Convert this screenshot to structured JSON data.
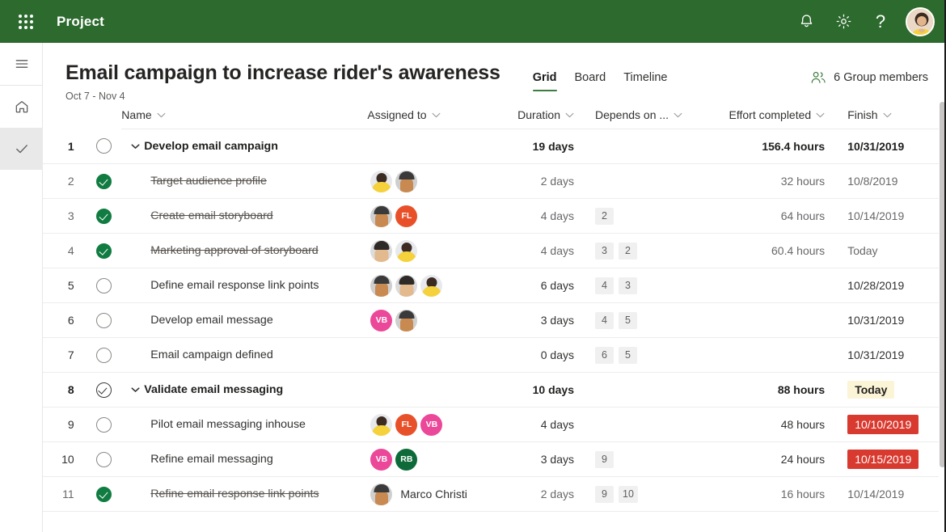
{
  "topbar": {
    "waffle_label": "App launcher",
    "app_title": "Project",
    "notifications_icon": "bell-icon",
    "settings_icon": "gear-icon",
    "help_label": "?",
    "avatar_label": "User account",
    "background_color": "#2d6a2e"
  },
  "rail": {
    "menu_icon": "hamburger-menu-icon",
    "home_icon": "home-icon",
    "tasks_icon": "checkmark-icon"
  },
  "header": {
    "title": "Email campaign to increase rider's awareness",
    "date_range": "Oct 7 - Nov 4",
    "tabs": [
      {
        "label": "Grid",
        "active": true
      },
      {
        "label": "Board",
        "active": false
      },
      {
        "label": "Timeline",
        "active": false
      }
    ],
    "group_members_label": "6 Group members",
    "group_members_icon": "people-icon",
    "accent_color": "#3e7d41"
  },
  "grid": {
    "columns": [
      {
        "key": "num",
        "label": ""
      },
      {
        "key": "check",
        "label": ""
      },
      {
        "key": "name",
        "label": "Name",
        "sortable": true
      },
      {
        "key": "assigned",
        "label": "Assigned to",
        "sortable": true
      },
      {
        "key": "duration",
        "label": "Duration",
        "sortable": true
      },
      {
        "key": "depends",
        "label": "Depends on ...",
        "sortable": true
      },
      {
        "key": "effort",
        "label": "Effort completed",
        "sortable": true
      },
      {
        "key": "finish",
        "label": "Finish",
        "sortable": true
      }
    ],
    "rows": [
      {
        "num": "1",
        "state": "open",
        "summary": true,
        "expanded": true,
        "name": "Develop email campaign",
        "avatars": [],
        "duration": "19 days",
        "depends": [],
        "effort": "156.4 hours",
        "finish": "10/31/2019",
        "finish_style": "plain"
      },
      {
        "num": "2",
        "state": "done",
        "summary": false,
        "name": "Target audience profile",
        "avatars": [
          {
            "type": "photo-f",
            "initials": ""
          },
          {
            "type": "photo-m",
            "initials": ""
          }
        ],
        "duration": "2 days",
        "depends": [],
        "effort": "32 hours",
        "finish": "10/8/2019",
        "finish_style": "plain"
      },
      {
        "num": "3",
        "state": "done",
        "summary": false,
        "name": "Create email storyboard",
        "avatars": [
          {
            "type": "photo-m",
            "initials": ""
          },
          {
            "type": "initials",
            "initials": "FL",
            "color": "#e8502a"
          }
        ],
        "duration": "4 days",
        "depends": [
          "2"
        ],
        "effort": "64 hours",
        "finish": "10/14/2019",
        "finish_style": "plain"
      },
      {
        "num": "4",
        "state": "done",
        "summary": false,
        "name": "Marketing approval of storyboard",
        "avatars": [
          {
            "type": "photo-m2",
            "initials": ""
          },
          {
            "type": "photo-f",
            "initials": ""
          }
        ],
        "duration": "4 days",
        "depends": [
          "3",
          "2"
        ],
        "effort": "60.4 hours",
        "finish": "Today",
        "finish_style": "plain"
      },
      {
        "num": "5",
        "state": "open",
        "summary": false,
        "name": "Define email response link points",
        "avatars": [
          {
            "type": "photo-m",
            "initials": ""
          },
          {
            "type": "photo-m2",
            "initials": ""
          },
          {
            "type": "photo-f",
            "initials": ""
          }
        ],
        "duration": "6 days",
        "depends": [
          "4",
          "3"
        ],
        "effort": "",
        "finish": "10/28/2019",
        "finish_style": "plain"
      },
      {
        "num": "6",
        "state": "open",
        "summary": false,
        "name": "Develop email message",
        "avatars": [
          {
            "type": "initials",
            "initials": "VB",
            "color": "#ec4899"
          },
          {
            "type": "photo-m",
            "initials": ""
          }
        ],
        "duration": "3 days",
        "depends": [
          "4",
          "5"
        ],
        "effort": "",
        "finish": "10/31/2019",
        "finish_style": "plain"
      },
      {
        "num": "7",
        "state": "open",
        "summary": false,
        "name": "Email campaign defined",
        "avatars": [],
        "duration": "0 days",
        "depends": [
          "6",
          "5"
        ],
        "effort": "",
        "finish": "10/31/2019",
        "finish_style": "plain"
      },
      {
        "num": "8",
        "state": "partial",
        "summary": true,
        "expanded": true,
        "name": "Validate email messaging",
        "avatars": [],
        "duration": "10 days",
        "depends": [],
        "effort": "88 hours",
        "finish": "Today",
        "finish_style": "today"
      },
      {
        "num": "9",
        "state": "open",
        "summary": false,
        "name": "Pilot email messaging inhouse",
        "avatars": [
          {
            "type": "photo-f",
            "initials": ""
          },
          {
            "type": "initials",
            "initials": "FL",
            "color": "#e8502a"
          },
          {
            "type": "initials",
            "initials": "VB",
            "color": "#ec4899"
          }
        ],
        "duration": "4 days",
        "depends": [],
        "effort": "48 hours",
        "finish": "10/10/2019",
        "finish_style": "late"
      },
      {
        "num": "10",
        "state": "open",
        "summary": false,
        "name": "Refine email messaging",
        "avatars": [
          {
            "type": "initials",
            "initials": "VB",
            "color": "#ec4899"
          },
          {
            "type": "initials",
            "initials": "RB",
            "color": "#0e6a38"
          }
        ],
        "duration": "3 days",
        "depends": [
          "9"
        ],
        "effort": "24 hours",
        "finish": "10/15/2019",
        "finish_style": "late"
      },
      {
        "num": "11",
        "state": "done",
        "summary": false,
        "name": "Refine email response link points",
        "avatars": [
          {
            "type": "photo-m",
            "initials": ""
          }
        ],
        "assignee_name": "Marco Christi",
        "duration": "2 days",
        "depends": [
          "9",
          "10"
        ],
        "effort": "16 hours",
        "finish": "10/14/2019",
        "finish_style": "plain"
      }
    ]
  },
  "colors": {
    "brand_green": "#2d6a2e",
    "done_green": "#107c41",
    "late_red": "#d93a30",
    "today_yellow": "#fbf4d6"
  }
}
